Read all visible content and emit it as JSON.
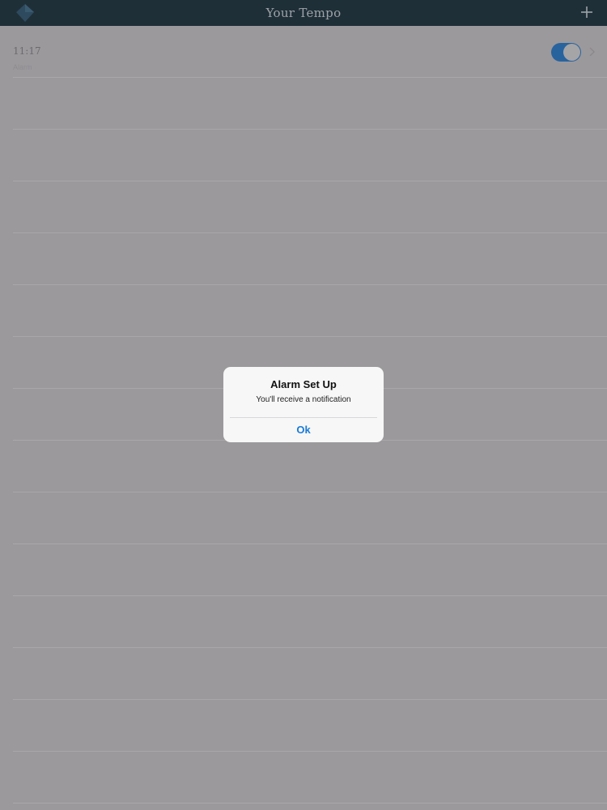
{
  "navbar": {
    "title": "Your Tempo",
    "logo_icon": "diamond-logo-icon",
    "add_icon": "plus-icon"
  },
  "alarms": [
    {
      "time": "11:17",
      "subtitle": "Alarm",
      "enabled": true
    }
  ],
  "empty_row_count": 14,
  "alert": {
    "title": "Alarm Set Up",
    "message": "You'll receive a notification",
    "ok_label": "Ok"
  },
  "colors": {
    "navbar_bg": "#1f2f38",
    "toggle_on": "#28639e",
    "alert_button": "#1a7ad8",
    "dimmed_bg": "#9b999c"
  }
}
